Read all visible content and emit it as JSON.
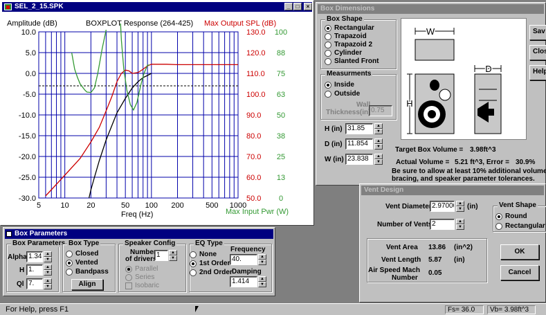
{
  "plot_window": {
    "title": "SEL_2_15.SPK",
    "chart_data": {
      "type": "line",
      "title": "BOXPLOT Response (264-425)",
      "ylabel_left": "Amplitude (dB)",
      "ylabel_right_spl": "Max Output SPL (dB)",
      "ylabel_right_pwr": "Max Input Pwr (W)",
      "xlabel": "Freq (Hz)",
      "x_scale": "log",
      "xlim": [
        5,
        1000
      ],
      "ylim": [
        -30,
        10
      ],
      "x_ticks": [
        "5",
        "10",
        "20",
        "50",
        "100",
        "200",
        "500",
        "1000"
      ],
      "y_ticks": [
        "10.0",
        "5.0",
        "0.0",
        "-5.0",
        "-10.0",
        "-15.0",
        "-20.0",
        "-25.0",
        "-30.0"
      ],
      "spl_ticks": [
        "130.0",
        "120.0",
        "110.0",
        "100.0",
        "90.0",
        "80.0",
        "70.0",
        "60.0",
        "50.0"
      ],
      "pwr_ticks": [
        "100",
        "88",
        "75",
        "63",
        "50",
        "38",
        "25",
        "13",
        "0"
      ],
      "reference_line_db": -3,
      "series": [
        {
          "name": "Amplitude",
          "color": "#000000",
          "points": [
            [
              19,
              -30
            ],
            [
              20,
              -28
            ],
            [
              22,
              -25
            ],
            [
              25,
              -21
            ],
            [
              30,
              -16
            ],
            [
              35,
              -12.5
            ],
            [
              40,
              -9.5
            ],
            [
              50,
              -6
            ],
            [
              60,
              -3.5
            ],
            [
              70,
              -2
            ],
            [
              80,
              -1
            ],
            [
              90,
              -0.5
            ],
            [
              100,
              0
            ]
          ]
        },
        {
          "name": "Max Output SPL",
          "color": "#cc0000",
          "points": [
            [
              6,
              -29.5
            ],
            [
              7,
              -28
            ],
            [
              10,
              -24.5
            ],
            [
              15,
              -20.5
            ],
            [
              20,
              -16.5
            ],
            [
              25,
              -13
            ],
            [
              30,
              -9
            ],
            [
              35,
              -5.5
            ],
            [
              40,
              -2
            ],
            [
              45,
              0
            ],
            [
              50,
              0.8
            ],
            [
              55,
              0.6
            ],
            [
              60,
              0
            ],
            [
              70,
              0.2
            ],
            [
              80,
              1
            ],
            [
              90,
              1.8
            ],
            [
              100,
              2.2
            ],
            [
              150,
              2.2
            ],
            [
              200,
              2.1
            ],
            [
              1000,
              2.1
            ]
          ]
        },
        {
          "name": "Max Input Pwr",
          "color": "#339933",
          "points": [
            [
              12,
              5
            ],
            [
              13,
              1
            ],
            [
              14,
              -1
            ],
            [
              15,
              -2.5
            ],
            [
              17,
              -4
            ],
            [
              18,
              -4.5
            ],
            [
              20,
              -4.6
            ],
            [
              22,
              -3.5
            ],
            [
              24,
              0
            ],
            [
              27,
              6
            ],
            [
              30,
              10.5
            ]
          ]
        },
        {
          "name": "Max Input Pwr (2)",
          "color": "#339933",
          "points": [
            [
              44,
              12
            ],
            [
              45,
              8
            ],
            [
              48,
              1
            ],
            [
              52,
              -4
            ],
            [
              57,
              -7.5
            ],
            [
              62,
              -8.8
            ],
            [
              68,
              -7
            ],
            [
              75,
              -3
            ],
            [
              82,
              0
            ],
            [
              90,
              2
            ],
            [
              95,
              2
            ]
          ]
        }
      ]
    }
  },
  "box_parameters": {
    "title": "Box Parameters",
    "params_group": "Box Parameters",
    "alpha_label": "Alpha",
    "alpha_value": "1.34",
    "h_label": "H",
    "h_value": "1.",
    "ql_label": "Ql",
    "ql_value": "7.",
    "box_type_group": "Box Type",
    "box_types": [
      "Closed",
      "Vented",
      "Bandpass"
    ],
    "align_button": "Align",
    "speaker_group": "Speaker Config",
    "num_drivers_label_1": "Number",
    "num_drivers_label_2": "of drivers",
    "num_drivers_value": "1",
    "speaker_configs": [
      "Parallel",
      "Series"
    ],
    "isobaric_label": "Isobaric",
    "eq_group": "EQ Type",
    "eq_types": [
      "None",
      "1st Order",
      "2nd Order"
    ],
    "frequency_label": "Frequency",
    "frequency_value": "40.",
    "damping_label": "Damping",
    "damping_value": "1.414"
  },
  "box_dimensions": {
    "title": "Box Dimensions",
    "shape_group": "Box Shape",
    "shapes": [
      "Rectangular",
      "Trapazoid",
      "Trapazoid 2",
      "Cylinder",
      "Slanted Front"
    ],
    "measure_group": "Measurments",
    "measures": [
      "Inside",
      "Outside"
    ],
    "wall_label_1": "Wall",
    "wall_label_2": "Thickness(in)",
    "wall_value": "0.75",
    "h_label": "H (in)",
    "h_value": "31.85",
    "d_label": "D (in)",
    "d_value": "11.854",
    "w_label": "W (in)",
    "w_value": "23.838",
    "diagram_w": "W",
    "diagram_h": "H",
    "diagram_d": "D",
    "target_label": "Target Box Volume =",
    "target_value": "3.98ft^3",
    "actual_label": "Actual Volume =",
    "actual_value": "5.21 ft^3, Error =",
    "error_value": "30.9%",
    "note_1": "Be sure to allow at least 10% additional volume for",
    "note_2": "bracing, and speaker parameter tolerances.",
    "save_button": "Sav",
    "close_button": "Clos",
    "help_button": "Help"
  },
  "vent_design": {
    "title": "Vent Design",
    "diameter_label": "Vent Diameter",
    "diameter_value": "2.97000",
    "diameter_unit": "(in)",
    "count_label": "Number of Vents",
    "count_value": "2",
    "shape_group": "Vent Shape",
    "shapes": [
      "Round",
      "Rectangular"
    ],
    "area_label": "Vent Area",
    "area_value": "13.86",
    "area_unit": "(in^2)",
    "length_label": "Vent Length",
    "length_value": "5.87",
    "length_unit": "(in)",
    "mach_label_1": "Air Speed Mach",
    "mach_label_2": "Number",
    "mach_value": "0.05",
    "ok_button": "OK",
    "cancel_button": "Cancel"
  },
  "status_bar": {
    "help_text": "For Help, press F1",
    "fs_text": "Fs= 36.0",
    "vb_text": "Vb= 3.98ft^3"
  }
}
